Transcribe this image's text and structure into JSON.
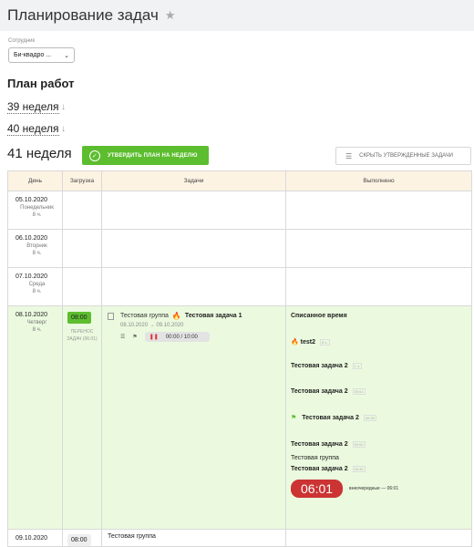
{
  "header": {
    "title": "Планирование задач",
    "star_icon": "star-icon"
  },
  "employee": {
    "label": "Сотрудник",
    "value": "Би-квадро ..."
  },
  "plan_title": "План работ",
  "weeks": [
    {
      "label": "39 неделя"
    },
    {
      "label": "40 неделя"
    }
  ],
  "current_week": "41 неделя",
  "buttons": {
    "approve": "УТВЕРДИТЬ ПЛАН НА НЕДЕЛЮ",
    "hide": "СКРЫТЬ УТВЕРЖДЕННЫЕ ЗАДАЧИ"
  },
  "table": {
    "headers": [
      "День",
      "Загрузка",
      "Задачи",
      "Выполнено"
    ],
    "days": [
      {
        "date": "05.10.2020",
        "weekday": "Понедельник",
        "hours": "8 ч."
      },
      {
        "date": "06.10.2020",
        "weekday": "Вторник",
        "hours": "8 ч."
      },
      {
        "date": "07.10.2020",
        "weekday": "Среда",
        "hours": "8 ч."
      },
      {
        "date": "08.10.2020",
        "weekday": "Четверг",
        "hours": "8 ч."
      },
      {
        "date": "09.10.2020"
      }
    ],
    "active": {
      "load": "08:00",
      "transfer": "ПЕРЕНОС ЗАДАЧ (06:01)",
      "task": {
        "group": "Тестовая группа",
        "name": "Тестовая задача 1",
        "date_from": "08.10.2020",
        "date_to": "09.10.2020",
        "timer": "00:00 / 10:00"
      },
      "done": {
        "heading": "Списанное время",
        "items": [
          {
            "name": "test2",
            "tag": "8 ч."
          },
          {
            "name": "Тестовая задача 2",
            "tag": "1 ч."
          },
          {
            "name": "Тестовая задача 2",
            "tag": "00:01"
          },
          {
            "name": "Тестовая задача 2",
            "tag": "00:30"
          },
          {
            "name": "Тестовая задача 2",
            "tag": "00:00"
          },
          {
            "group": "Тестовая группа",
            "name": "Тестовая задача 2",
            "tag": "00:30"
          }
        ],
        "total": "06:01",
        "overtime": "внеочередные — 06:01"
      }
    },
    "last": {
      "load": "08:00",
      "group": "Тестовая группа"
    }
  },
  "colors": {
    "accent_green": "#5cbd2e",
    "active_row": "#ebfadf",
    "header_bg": "#fdf3e3",
    "timer_red": "#cc3333"
  }
}
